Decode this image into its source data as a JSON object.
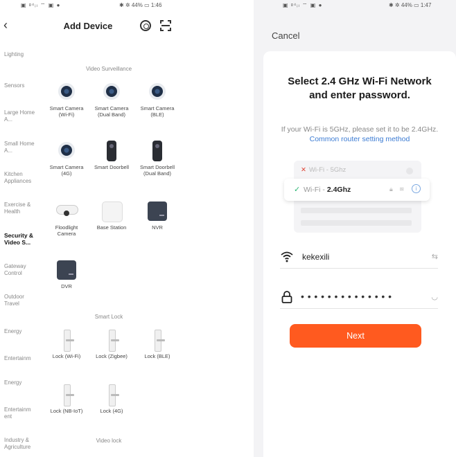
{
  "left": {
    "status": {
      "left_icons": "▣ ᵍ⁴ᵢₗ ⌔ ▣ ●",
      "right": "✱ ✲ 44% ▭ 1:46"
    },
    "header": {
      "title": "Add Device"
    },
    "sidebar": [
      "Lighting",
      "Sensors",
      "Large Home A...",
      "Small Home A...",
      "Kitchen Appliances",
      "Exercise & Health",
      "Security & Video S...",
      "Gateway Control",
      "Outdoor Travel",
      "Energy",
      "Entertainm",
      "Energy",
      "Entertainm ent",
      "Industry & Agriculture"
    ],
    "sections": {
      "video_surveillance": "Video Surveillance",
      "smart_lock": "Smart Lock",
      "video_lock": "Video lock"
    },
    "devices": {
      "cam_wifi": "Smart Camera (Wi-Fi)",
      "cam_dual": "Smart Camera (Dual Band)",
      "cam_ble": "Smart Camera (BLE)",
      "cam_4g": "Smart Camera (4G)",
      "doorbell": "Smart Doorbell",
      "doorbell_dual": "Smart Doorbell (Dual Band)",
      "floodlight": "Floodlight Camera",
      "base_station": "Base Station",
      "nvr": "NVR",
      "dvr": "DVR",
      "lock_wifi": "Lock (Wi-Fi)",
      "lock_zigbee": "Lock (Zigbee)",
      "lock_ble": "Lock (BLE)",
      "lock_nbiot": "Lock (NB-IoT)",
      "lock_4g": "Lock (4G)"
    }
  },
  "right": {
    "status": {
      "left_icons": "▣ ᵍ⁴ᵢₗ ⌔ ▣ ●",
      "right": "✱ ✲ 44% ▭ 1:47"
    },
    "cancel_label": "Cancel",
    "title": "Select 2.4 GHz Wi-Fi Network and enter password.",
    "desc_prefix": "If your Wi-Fi is 5GHz, please set it to be 2.4GHz. ",
    "desc_link": "Common router setting method",
    "illustration": {
      "bad_network": "Wi-Fi - 5Ghz",
      "good_prefix": "Wi-Fi - ",
      "good_band": "2.4Ghz"
    },
    "ssid_value": "kekexili",
    "password_mask": "••••••••••••••",
    "next_label": "Next"
  },
  "colors": {
    "accent_orange": "#ff5a1f",
    "link_blue": "#3b7bd3",
    "check_green": "#2bb673",
    "error_red": "#e04a3a"
  }
}
